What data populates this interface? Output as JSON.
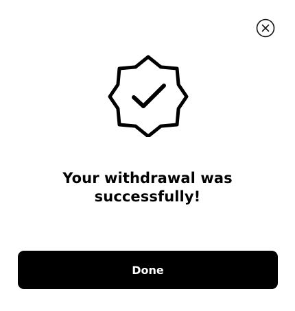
{
  "dialog": {
    "close_icon": "close-circle-icon",
    "badge_icon": "verified-check-badge-icon",
    "message": "Your withdrawal was successfully!",
    "done_label": "Done"
  },
  "colors": {
    "background": "#ffffff",
    "primary": "#000000",
    "button_text": "#ffffff"
  }
}
